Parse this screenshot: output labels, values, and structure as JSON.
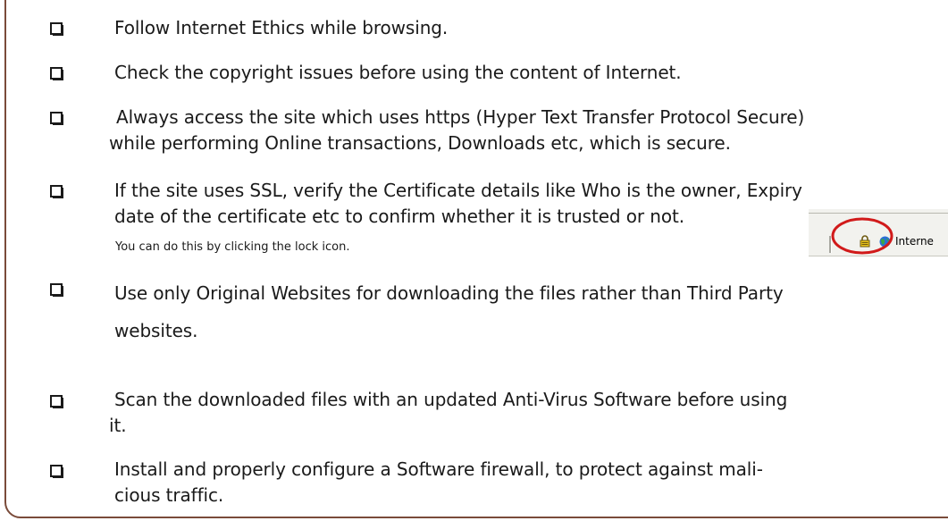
{
  "items": [
    {
      "lines": [
        "Follow Internet Ethics while browsing."
      ]
    },
    {
      "lines": [
        "Check the copyright issues before using the content of Internet."
      ]
    },
    {
      "lines": [
        "Always access the site which uses https (Hyper Text Transfer Protocol Secure)",
        "while performing Online transactions, Downloads etc, which is secure."
      ]
    },
    {
      "lines": [
        "If the site uses SSL, verify the Certificate details like Who is the owner, Expiry",
        "date of the certificate etc to confirm whether it is trusted or not."
      ]
    },
    {
      "lines": [
        "Use only Original Websites for downloading the files rather than Third Party",
        "websites."
      ]
    },
    {
      "lines": [
        "Scan the downloaded files with an updated Anti-Virus Software before using",
        "it."
      ]
    },
    {
      "lines": [
        "Install and properly configure a Software firewall, to protect against mali-",
        "cious traffic."
      ]
    }
  ],
  "note": "You can do this by clicking the lock icon.",
  "browser_status": {
    "label": "Interne",
    "icons": [
      "lock-icon",
      "globe-icon"
    ]
  },
  "colors": {
    "frame": "#7a4b3a",
    "highlight_circle": "#d11a1a",
    "lock": "#e8c21a"
  }
}
